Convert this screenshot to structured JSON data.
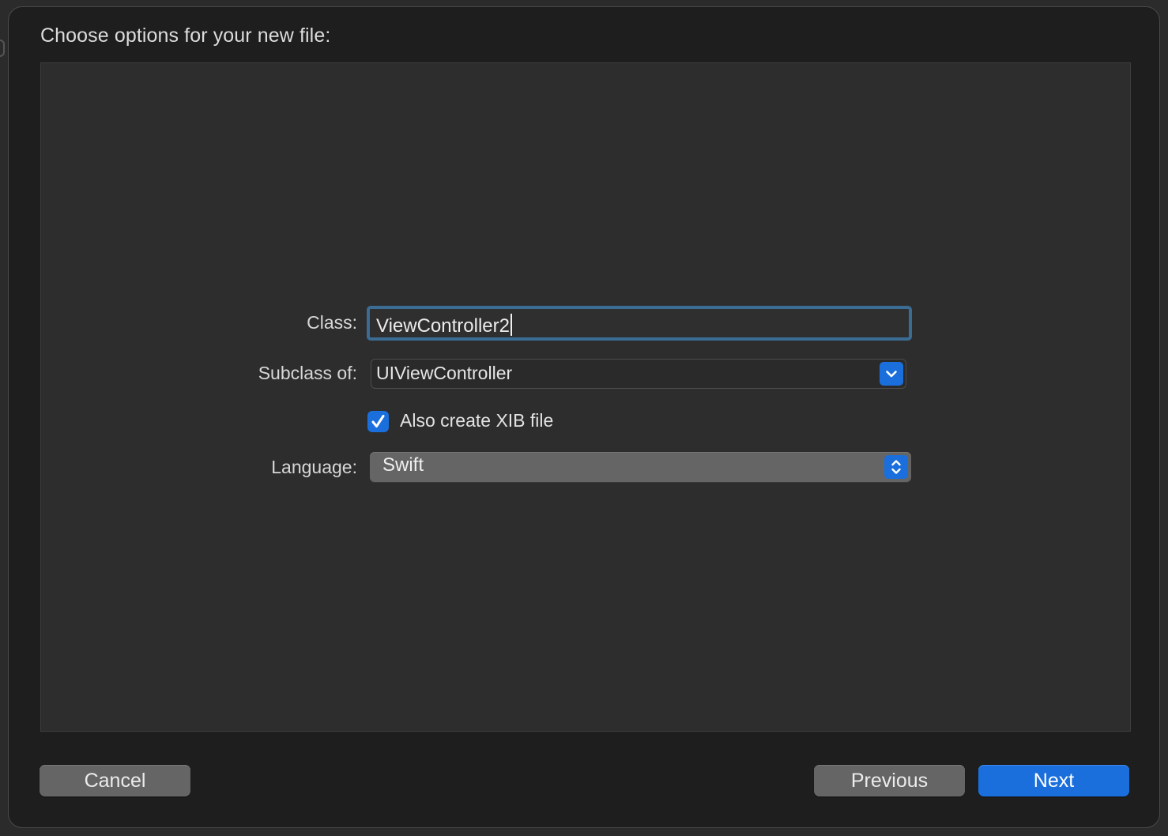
{
  "dialog": {
    "title": "Choose options for your new file:"
  },
  "form": {
    "class_label": "Class:",
    "class_value": "ViewController2",
    "subclass_label": "Subclass of:",
    "subclass_value": "UIViewController",
    "xib_checkbox_label": "Also create XIB file",
    "xib_checked": true,
    "language_label": "Language:",
    "language_value": "Swift"
  },
  "buttons": {
    "cancel": "Cancel",
    "previous": "Previous",
    "next": "Next"
  },
  "icons": {
    "combo": "chevron-down-icon",
    "popup": "up-down-chevrons-icon",
    "checkbox": "checkmark-icon"
  },
  "colors": {
    "accent": "#1a6fdc",
    "focus_ring": "#3b6c94",
    "sheet_background": "#1e1e1e",
    "panel_background": "#2d2d2d"
  }
}
